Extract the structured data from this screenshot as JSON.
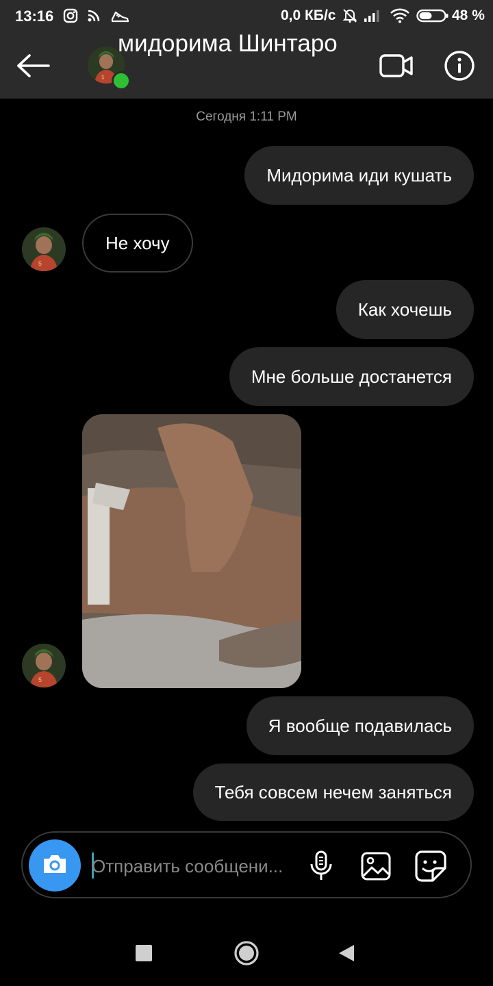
{
  "status_bar": {
    "time": "13:16",
    "network_speed": "0,0 КБ/с",
    "battery_percent": "48 %",
    "icons": [
      "instagram-icon",
      "cast-icon",
      "shoe-icon",
      "mute-icon",
      "signal-icon",
      "wifi-icon",
      "battery-icon"
    ]
  },
  "header": {
    "title": "мидорима Шинтаро",
    "online": true,
    "icons": [
      "back-arrow-icon",
      "video-call-icon",
      "info-icon"
    ]
  },
  "chat": {
    "timestamp": "Сегодня 1:11 PM",
    "messages": [
      {
        "from": "me",
        "text": "Мидорима иди кушать"
      },
      {
        "from": "them",
        "text": "Не хочу"
      },
      {
        "from": "me",
        "text": "Как хочешь"
      },
      {
        "from": "me",
        "text": "Мне больше достанется"
      },
      {
        "from": "them",
        "type": "photo"
      },
      {
        "from": "me",
        "text": "Я вообще подавилась"
      },
      {
        "from": "me",
        "text": "Тебя совсем нечем заняться"
      }
    ]
  },
  "composer": {
    "placeholder": "Отправить сообщени...",
    "icons": [
      "camera-icon",
      "microphone-icon",
      "gallery-icon",
      "sticker-icon"
    ]
  },
  "nav": {
    "icons": [
      "recents-square-icon",
      "home-circle-icon",
      "back-triangle-icon"
    ]
  },
  "colors": {
    "bar_bg": "#2b2b2b",
    "outgoing_bubble": "#262626",
    "camera_button": "#3897f0",
    "online_dot": "#2fbf35"
  }
}
